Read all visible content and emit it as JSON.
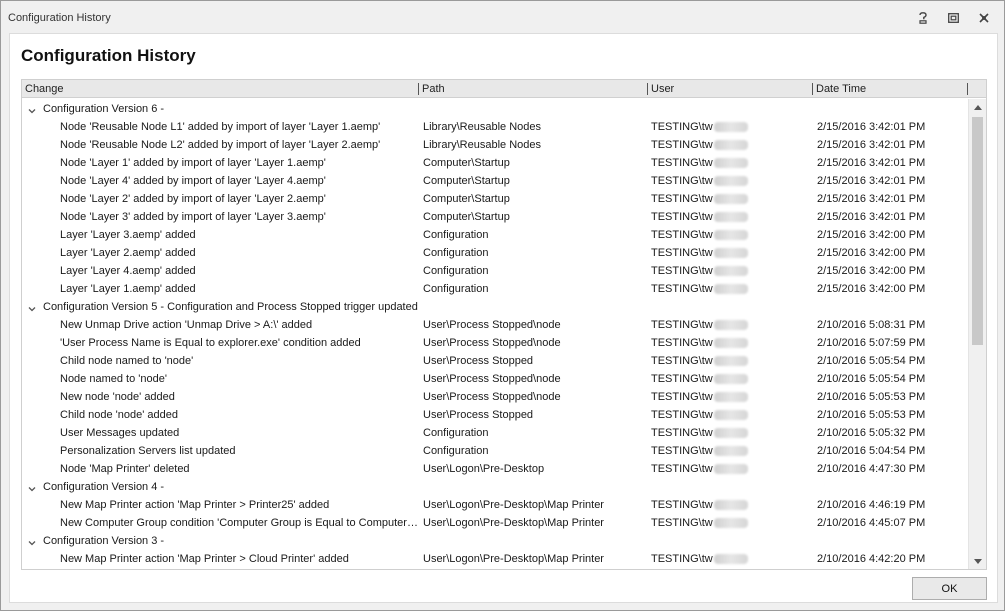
{
  "window": {
    "title": "Configuration History"
  },
  "heading": "Configuration History",
  "columns": {
    "change": "Change",
    "path": "Path",
    "user": "User",
    "datetime": "Date Time"
  },
  "groups": [
    {
      "label": "Configuration Version 6 -",
      "rows": [
        {
          "change": "Node 'Reusable Node L1' added by import of layer 'Layer 1.aemp'",
          "path": "Library\\Reusable Nodes",
          "user": "TESTING\\tw",
          "datetime": "2/15/2016 3:42:01 PM"
        },
        {
          "change": "Node 'Reusable Node L2' added by import of layer 'Layer 2.aemp'",
          "path": "Library\\Reusable Nodes",
          "user": "TESTING\\tw",
          "datetime": "2/15/2016 3:42:01 PM"
        },
        {
          "change": "Node 'Layer 1' added by import of layer 'Layer 1.aemp'",
          "path": "Computer\\Startup",
          "user": "TESTING\\tw",
          "datetime": "2/15/2016 3:42:01 PM"
        },
        {
          "change": "Node 'Layer 4' added by import of layer 'Layer 4.aemp'",
          "path": "Computer\\Startup",
          "user": "TESTING\\tw",
          "datetime": "2/15/2016 3:42:01 PM"
        },
        {
          "change": "Node 'Layer 2' added by import of layer 'Layer 2.aemp'",
          "path": "Computer\\Startup",
          "user": "TESTING\\tw",
          "datetime": "2/15/2016 3:42:01 PM"
        },
        {
          "change": "Node 'Layer 3' added by import of layer 'Layer 3.aemp'",
          "path": "Computer\\Startup",
          "user": "TESTING\\tw",
          "datetime": "2/15/2016 3:42:01 PM"
        },
        {
          "change": "Layer 'Layer 3.aemp' added",
          "path": "Configuration",
          "user": "TESTING\\tw",
          "datetime": "2/15/2016 3:42:00 PM"
        },
        {
          "change": "Layer 'Layer 2.aemp' added",
          "path": "Configuration",
          "user": "TESTING\\tw",
          "datetime": "2/15/2016 3:42:00 PM"
        },
        {
          "change": "Layer 'Layer 4.aemp' added",
          "path": "Configuration",
          "user": "TESTING\\tw",
          "datetime": "2/15/2016 3:42:00 PM"
        },
        {
          "change": "Layer 'Layer 1.aemp' added",
          "path": "Configuration",
          "user": "TESTING\\tw",
          "datetime": "2/15/2016 3:42:00 PM"
        }
      ]
    },
    {
      "label": "Configuration Version 5 - Configuration and Process Stopped trigger updated",
      "rows": [
        {
          "change": "New Unmap Drive action 'Unmap Drive > A:\\' added",
          "path": "User\\Process Stopped\\node",
          "user": "TESTING\\tw",
          "datetime": "2/10/2016 5:08:31 PM"
        },
        {
          "change": "'User Process Name is Equal to explorer.exe' condition added",
          "path": "User\\Process Stopped\\node",
          "user": "TESTING\\tw",
          "datetime": "2/10/2016 5:07:59 PM"
        },
        {
          "change": "Child node named to 'node'",
          "path": "User\\Process Stopped",
          "user": "TESTING\\tw",
          "datetime": "2/10/2016 5:05:54 PM"
        },
        {
          "change": "Node named to 'node'",
          "path": "User\\Process Stopped\\node",
          "user": "TESTING\\tw",
          "datetime": "2/10/2016 5:05:54 PM"
        },
        {
          "change": "New node 'node' added",
          "path": "User\\Process Stopped\\node",
          "user": "TESTING\\tw",
          "datetime": "2/10/2016 5:05:53 PM"
        },
        {
          "change": "Child node 'node' added",
          "path": "User\\Process Stopped",
          "user": "TESTING\\tw",
          "datetime": "2/10/2016 5:05:53 PM"
        },
        {
          "change": "User Messages updated",
          "path": "Configuration",
          "user": "TESTING\\tw",
          "datetime": "2/10/2016 5:05:32 PM"
        },
        {
          "change": "Personalization Servers list updated",
          "path": "Configuration",
          "user": "TESTING\\tw",
          "datetime": "2/10/2016 5:04:54 PM"
        },
        {
          "change": "Node 'Map Printer' deleted",
          "path": "User\\Logon\\Pre-Desktop",
          "user": "TESTING\\tw",
          "datetime": "2/10/2016 4:47:30 PM"
        }
      ]
    },
    {
      "label": "Configuration Version 4 -",
      "rows": [
        {
          "change": "New Map Printer action 'Map Printer > Printer25' added",
          "path": "User\\Logon\\Pre-Desktop\\Map Printer",
          "user": "TESTING\\tw",
          "datetime": "2/10/2016 4:46:19 PM"
        },
        {
          "change": "New Computer Group condition 'Computer Group is Equal to ComputerG...",
          "path": "User\\Logon\\Pre-Desktop\\Map Printer",
          "user": "TESTING\\tw",
          "datetime": "2/10/2016 4:45:07 PM"
        }
      ]
    },
    {
      "label": "Configuration Version 3 -",
      "rows": [
        {
          "change": "New Map Printer action 'Map Printer > Cloud Printer' added",
          "path": "User\\Logon\\Pre-Desktop\\Map Printer",
          "user": "TESTING\\tw",
          "datetime": "2/10/2016 4:42:20 PM"
        }
      ]
    }
  ],
  "ok_label": "OK",
  "icons": {
    "help": "help-icon",
    "restore": "restore-icon",
    "close": "close-icon",
    "expand": "chevron-down-icon"
  }
}
